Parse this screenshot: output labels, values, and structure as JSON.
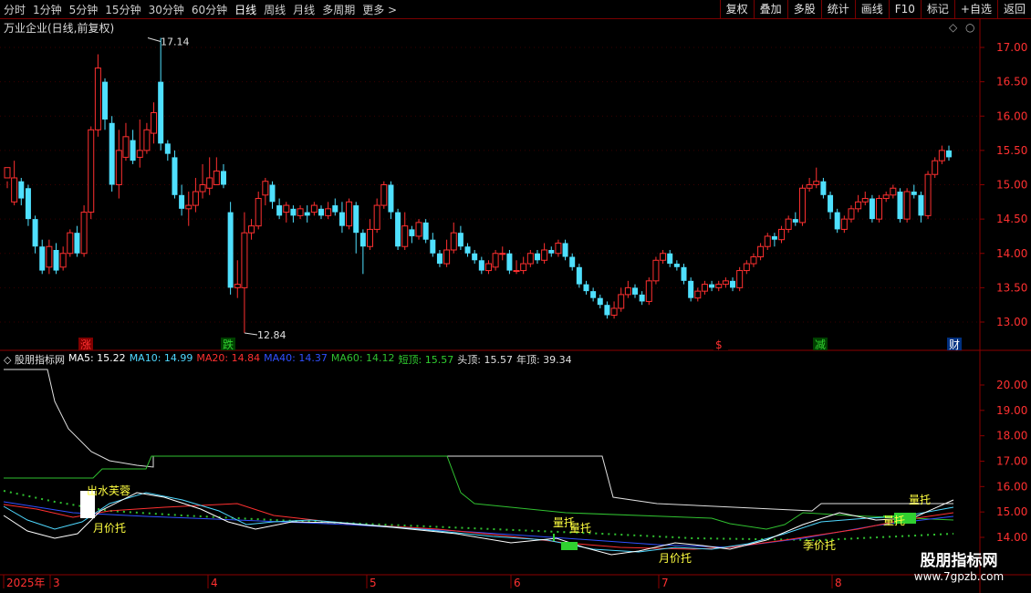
{
  "toolbar": {
    "periods": [
      "分时",
      "1分钟",
      "5分钟",
      "15分钟",
      "30分钟",
      "60分钟",
      "日线",
      "周线",
      "月线",
      "多周期",
      "更多 >"
    ],
    "active": "日线",
    "actions": [
      "复权",
      "叠加",
      "多股",
      "统计",
      "画线",
      "F10",
      "+自选",
      "返回"
    ],
    "mark_label": "标记"
  },
  "main_pane": {
    "title": "万业企业(日线,前复权)",
    "high_label": "17.14",
    "low_label": "12.84",
    "price_ticks": [
      "17.00",
      "16.50",
      "16.00",
      "15.50",
      "15.00",
      "14.50",
      "14.00",
      "13.50",
      "13.00"
    ],
    "markers": [
      "涨",
      "跌",
      "$",
      "减",
      "财"
    ]
  },
  "indicator_pane": {
    "name": "股朋指标网",
    "items": [
      {
        "label": "MA5: 15.22",
        "color": "#ffffff"
      },
      {
        "label": "MA10: 14.99",
        "color": "#4fd8ff"
      },
      {
        "label": "MA20: 14.84",
        "color": "#ff3030"
      },
      {
        "label": "MA40: 14.37",
        "color": "#3050ff"
      },
      {
        "label": "MA60: 14.12",
        "color": "#30c030"
      },
      {
        "label": "短顶: 15.57",
        "color": "#30d030"
      },
      {
        "label": "头顶: 15.57",
        "color": "#e0e0e0"
      },
      {
        "label": "年顶: 39.34",
        "color": "#e0e0e0"
      }
    ],
    "ticks": [
      "20.00",
      "19.00",
      "18.00",
      "17.00",
      "16.00",
      "15.00",
      "14.00"
    ],
    "annotations": {
      "a1": "出水芙蓉",
      "a2": "月价托",
      "a3": "量托",
      "a4": "量托",
      "a5": "月价托",
      "a6": "季价托",
      "a7": "量托",
      "a8": "量托"
    }
  },
  "time_axis": {
    "labels": [
      "2025年",
      "3",
      "4",
      "5",
      "6",
      "7",
      "8"
    ]
  },
  "watermark": {
    "title": "股朋指标网",
    "url": "www.7gpzb.com"
  },
  "candles": [
    [
      15.1,
      15.25,
      15.05,
      14.95
    ],
    [
      14.75,
      15.1,
      15.35,
      14.7
    ],
    [
      15.05,
      14.8,
      15.1,
      14.7
    ],
    [
      14.95,
      14.5,
      15.0,
      14.4
    ],
    [
      14.5,
      14.1,
      14.55,
      14.0
    ],
    [
      14.1,
      13.75,
      14.2,
      13.7
    ],
    [
      13.8,
      14.1,
      14.2,
      13.7
    ],
    [
      14.05,
      13.75,
      14.15,
      13.7
    ],
    [
      13.8,
      14.0,
      14.1,
      13.75
    ],
    [
      14.0,
      14.3,
      14.35,
      13.95
    ],
    [
      14.3,
      14.0,
      14.4,
      13.95
    ],
    [
      14.0,
      14.6,
      14.7,
      13.95
    ],
    [
      14.6,
      15.8,
      15.85,
      14.5
    ],
    [
      15.8,
      16.7,
      16.9,
      15.7
    ],
    [
      16.5,
      15.95,
      16.55,
      15.8
    ],
    [
      15.9,
      15.0,
      16.0,
      14.9
    ],
    [
      15.0,
      15.5,
      15.8,
      14.8
    ],
    [
      15.4,
      15.7,
      15.9,
      15.35
    ],
    [
      15.65,
      15.35,
      15.8,
      15.3
    ],
    [
      15.4,
      15.5,
      15.95,
      15.25
    ],
    [
      15.5,
      15.8,
      15.9,
      15.45
    ],
    [
      15.75,
      16.05,
      16.2,
      15.6
    ],
    [
      16.5,
      15.6,
      17.14,
      15.5
    ],
    [
      15.6,
      15.45,
      15.65,
      15.35
    ],
    [
      15.4,
      14.85,
      15.5,
      14.8
    ],
    [
      14.85,
      14.65,
      15.0,
      14.55
    ],
    [
      14.65,
      14.7,
      14.9,
      14.4
    ],
    [
      14.7,
      14.9,
      15.1,
      14.6
    ],
    [
      14.9,
      15.0,
      15.3,
      14.8
    ],
    [
      14.95,
      15.1,
      15.4,
      14.85
    ],
    [
      15.0,
      15.2,
      15.4,
      15.1
    ],
    [
      15.2,
      15.0,
      15.3,
      14.95
    ],
    [
      14.6,
      13.5,
      14.75,
      13.4
    ],
    [
      13.5,
      13.55,
      13.9,
      13.35
    ],
    [
      13.5,
      14.3,
      14.6,
      12.84
    ],
    [
      14.3,
      14.4,
      14.5,
      14.2
    ],
    [
      14.4,
      14.8,
      14.9,
      14.35
    ],
    [
      14.85,
      15.05,
      15.1,
      14.7
    ],
    [
      15.0,
      14.75,
      15.05,
      14.65
    ],
    [
      14.7,
      14.55,
      14.8,
      14.5
    ],
    [
      14.6,
      14.7,
      14.75,
      14.45
    ],
    [
      14.65,
      14.55,
      14.7,
      14.45
    ],
    [
      14.55,
      14.65,
      14.7,
      14.5
    ],
    [
      14.6,
      14.55,
      14.7,
      14.45
    ],
    [
      14.6,
      14.7,
      14.75,
      14.55
    ],
    [
      14.65,
      14.55,
      14.7,
      14.5
    ],
    [
      14.55,
      14.65,
      14.75,
      14.5
    ],
    [
      14.7,
      14.6,
      14.8,
      14.55
    ],
    [
      14.6,
      14.4,
      14.75,
      14.3
    ],
    [
      14.4,
      14.75,
      14.8,
      14.35
    ],
    [
      14.7,
      14.3,
      14.75,
      14.0
    ],
    [
      14.3,
      14.1,
      14.35,
      13.7
    ],
    [
      14.1,
      14.35,
      14.5,
      14.05
    ],
    [
      14.35,
      14.7,
      14.8,
      14.3
    ],
    [
      14.7,
      15.0,
      15.05,
      14.65
    ],
    [
      15.0,
      14.6,
      15.05,
      14.5
    ],
    [
      14.6,
      14.1,
      14.65,
      14.05
    ],
    [
      14.1,
      14.4,
      14.6,
      14.05
    ],
    [
      14.35,
      14.25,
      14.4,
      14.15
    ],
    [
      14.25,
      14.45,
      14.5,
      14.2
    ],
    [
      14.45,
      14.2,
      14.5,
      14.15
    ],
    [
      14.2,
      14.0,
      14.3,
      13.95
    ],
    [
      14.0,
      13.85,
      14.05,
      13.8
    ],
    [
      13.85,
      14.05,
      14.2,
      13.8
    ],
    [
      14.05,
      14.3,
      14.45,
      14.0
    ],
    [
      14.3,
      14.1,
      14.4,
      14.05
    ],
    [
      14.1,
      14.0,
      14.15,
      13.95
    ],
    [
      14.0,
      13.9,
      14.05,
      13.85
    ],
    [
      13.9,
      13.75,
      13.95,
      13.7
    ],
    [
      13.75,
      13.85,
      13.9,
      13.7
    ],
    [
      13.8,
      14.0,
      14.05,
      13.75
    ],
    [
      14.0,
      14.0,
      14.1,
      13.9
    ],
    [
      14.0,
      13.75,
      14.05,
      13.7
    ],
    [
      13.75,
      13.75,
      13.9,
      13.7
    ],
    [
      13.75,
      13.85,
      13.95,
      13.7
    ],
    [
      13.85,
      14.0,
      14.05,
      13.8
    ],
    [
      14.0,
      13.9,
      14.05,
      13.85
    ],
    [
      13.9,
      14.05,
      14.15,
      13.85
    ],
    [
      14.05,
      14.0,
      14.1,
      13.95
    ],
    [
      14.0,
      14.15,
      14.2,
      13.95
    ],
    [
      14.15,
      13.95,
      14.2,
      13.9
    ],
    [
      13.95,
      13.8,
      14.0,
      13.75
    ],
    [
      13.8,
      13.55,
      13.85,
      13.5
    ],
    [
      13.55,
      13.45,
      13.6,
      13.4
    ],
    [
      13.45,
      13.35,
      13.5,
      13.3
    ],
    [
      13.35,
      13.25,
      13.4,
      13.2
    ],
    [
      13.25,
      13.1,
      13.3,
      13.05
    ],
    [
      13.1,
      13.2,
      13.3,
      13.05
    ],
    [
      13.2,
      13.4,
      13.5,
      13.15
    ],
    [
      13.4,
      13.5,
      13.6,
      13.35
    ],
    [
      13.5,
      13.4,
      13.55,
      13.35
    ],
    [
      13.4,
      13.3,
      13.45,
      13.25
    ],
    [
      13.3,
      13.6,
      13.65,
      13.25
    ],
    [
      13.6,
      13.9,
      13.95,
      13.55
    ],
    [
      13.9,
      14.0,
      14.05,
      13.85
    ],
    [
      14.0,
      13.85,
      14.05,
      13.8
    ],
    [
      13.85,
      13.8,
      13.9,
      13.75
    ],
    [
      13.8,
      13.6,
      13.85,
      13.55
    ],
    [
      13.6,
      13.35,
      13.65,
      13.3
    ],
    [
      13.35,
      13.45,
      13.5,
      13.3
    ],
    [
      13.45,
      13.55,
      13.6,
      13.4
    ],
    [
      13.55,
      13.5,
      13.6,
      13.45
    ],
    [
      13.5,
      13.55,
      13.6,
      13.45
    ],
    [
      13.55,
      13.6,
      13.65,
      13.5
    ],
    [
      13.6,
      13.5,
      13.65,
      13.45
    ],
    [
      13.5,
      13.75,
      13.8,
      13.45
    ],
    [
      13.75,
      13.85,
      13.9,
      13.7
    ],
    [
      13.85,
      13.95,
      14.0,
      13.8
    ],
    [
      13.95,
      14.1,
      14.15,
      13.9
    ],
    [
      14.1,
      14.25,
      14.3,
      14.05
    ],
    [
      14.25,
      14.2,
      14.3,
      14.1
    ],
    [
      14.2,
      14.35,
      14.4,
      14.15
    ],
    [
      14.35,
      14.5,
      14.55,
      14.3
    ],
    [
      14.5,
      14.45,
      14.6,
      14.4
    ],
    [
      14.45,
      14.95,
      15.0,
      14.4
    ],
    [
      14.95,
      15.0,
      15.1,
      14.9
    ],
    [
      15.0,
      15.05,
      15.25,
      14.95
    ],
    [
      15.05,
      14.85,
      15.1,
      14.8
    ],
    [
      14.85,
      14.6,
      14.9,
      14.5
    ],
    [
      14.6,
      14.35,
      14.65,
      14.3
    ],
    [
      14.35,
      14.5,
      14.55,
      14.3
    ],
    [
      14.5,
      14.65,
      14.7,
      14.45
    ],
    [
      14.65,
      14.75,
      14.85,
      14.6
    ],
    [
      14.75,
      14.8,
      14.9,
      14.7
    ],
    [
      14.8,
      14.5,
      14.85,
      14.45
    ],
    [
      14.5,
      14.8,
      14.85,
      14.45
    ],
    [
      14.8,
      14.85,
      14.9,
      14.75
    ],
    [
      14.85,
      14.95,
      15.0,
      14.8
    ],
    [
      14.9,
      14.5,
      14.95,
      14.45
    ],
    [
      14.5,
      14.9,
      14.95,
      14.45
    ],
    [
      14.9,
      14.85,
      15.0,
      14.8
    ],
    [
      14.85,
      14.55,
      14.9,
      14.45
    ],
    [
      14.55,
      15.15,
      15.2,
      14.5
    ],
    [
      15.15,
      15.35,
      15.4,
      15.1
    ],
    [
      15.35,
      15.5,
      15.57,
      15.3
    ],
    [
      15.5,
      15.4,
      15.57,
      15.35
    ]
  ]
}
